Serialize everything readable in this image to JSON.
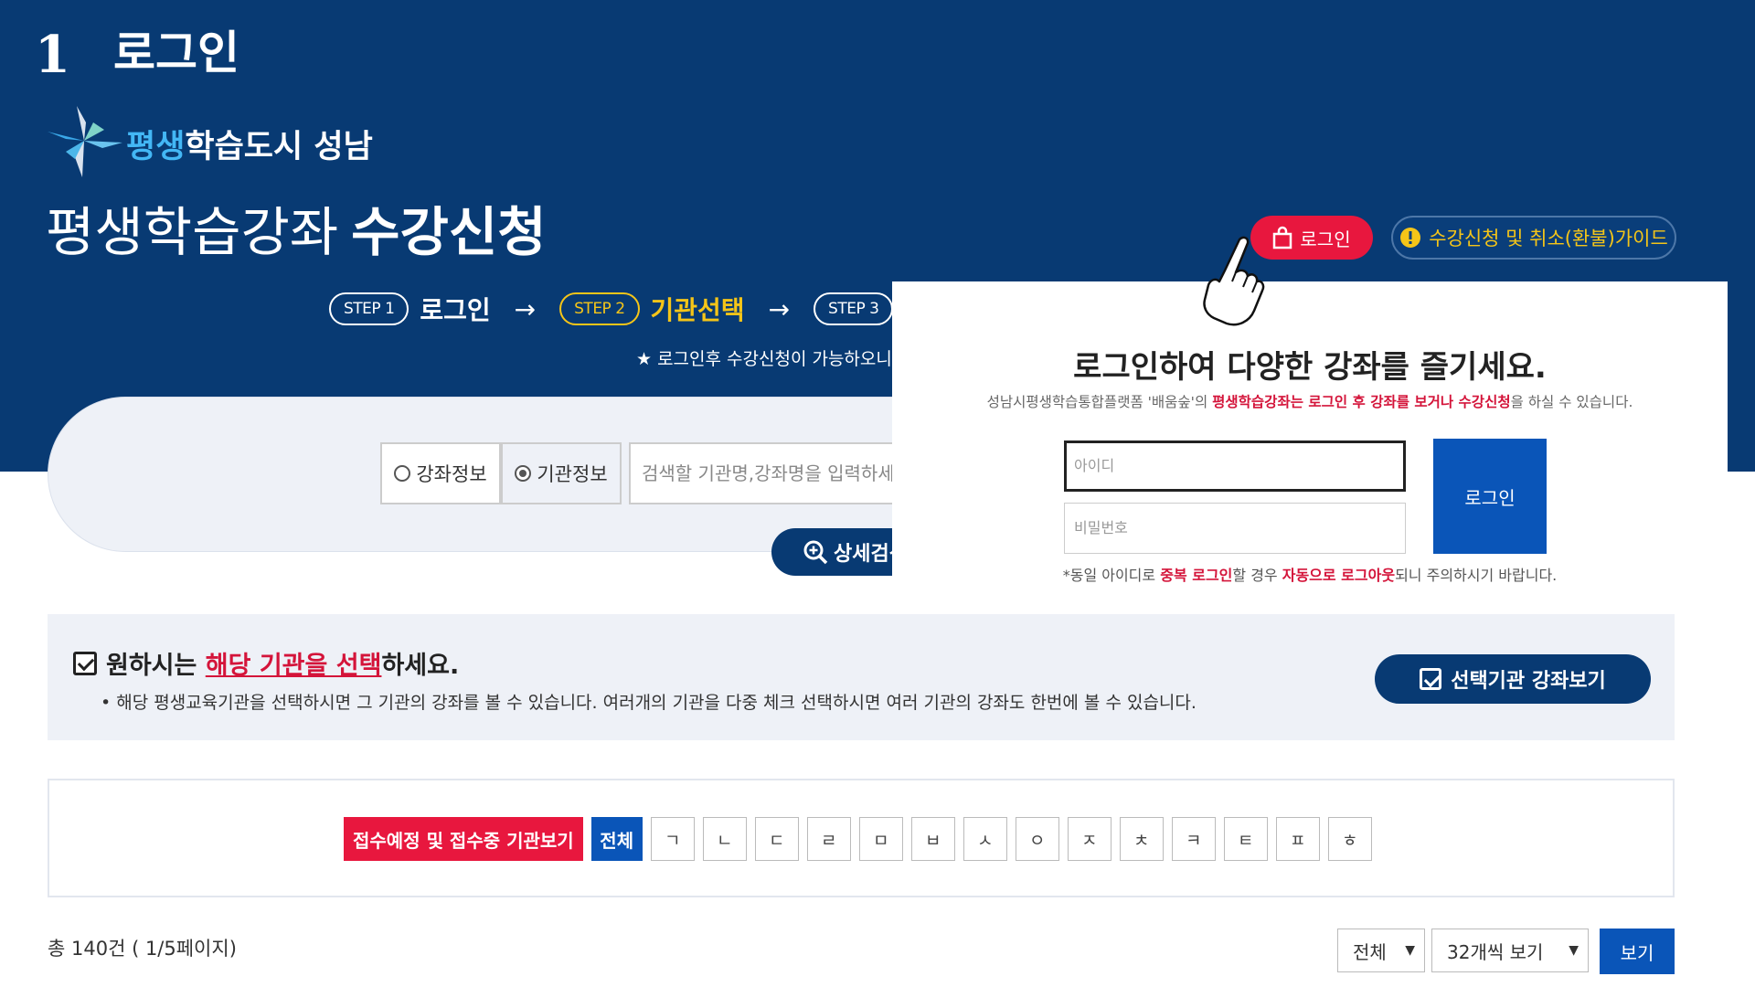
{
  "step_header": {
    "number": "1",
    "label": "로그인"
  },
  "logo": {
    "accent": "평생",
    "rest": "학습도시 성남"
  },
  "title": {
    "light": "평생학습강좌",
    "bold": "수강신청"
  },
  "steps": [
    {
      "pill": "STEP 1",
      "name": "로그인"
    },
    {
      "pill": "STEP 2",
      "name": "기관선택"
    },
    {
      "pill": "STEP 3"
    }
  ],
  "steps_arrow": "→",
  "notice": "★ 로그인후 수강신청이 가능하오니",
  "header_buttons": {
    "login": "로그인",
    "guide": "수강신청 및 취소(환불)가이드"
  },
  "search": {
    "radio_course": "강좌정보",
    "radio_institution": "기관정보",
    "placeholder": "검색할 기관명,강좌명을 입력하세요",
    "detail_button": "상세검색"
  },
  "modal": {
    "title": "로그인하여 다양한 강좌를 즐기세요.",
    "desc_prefix": "성남시평생학습통합플랫폼 '배움숲'의 ",
    "desc_red": "평생학습강좌는 로그인 후 강좌를 보거나 수강신청",
    "desc_suffix": "을 하실 수 있습니다.",
    "id_placeholder": "아이디",
    "pw_placeholder": "비밀번호",
    "login_button": "로그인",
    "note_1": "*동일 아이디로 ",
    "note_red_1": "중복 로그인",
    "note_2": "할 경우 ",
    "note_red_2": "자동으로 로그아웃",
    "note_3": "되니 주의하시기 바랍니다."
  },
  "select_section": {
    "heading_1": "원하시는 ",
    "heading_hl": "해당 기관을 선택",
    "heading_2": "하세요.",
    "desc": "• 해당 평생교육기관을 선택하시면 그 기관의 강좌를 볼 수 있습니다. 여러개의 기관을 다중 체크 선택하시면 여러 기관의 강좌도 한번에 볼 수 있습니다.",
    "view_button": "선택기관 강좌보기"
  },
  "filter": {
    "reception_button": "접수예정 및 접수중 기관보기",
    "all_button": "전체",
    "consonants": [
      "ㄱ",
      "ㄴ",
      "ㄷ",
      "ㄹ",
      "ㅁ",
      "ㅂ",
      "ㅅ",
      "ㅇ",
      "ㅈ",
      "ㅊ",
      "ㅋ",
      "ㅌ",
      "ㅍ",
      "ㅎ"
    ]
  },
  "list_footer": {
    "total": "총 140건 ( 1/5페이지)",
    "select_all": "전체",
    "select_count": "32개씩 보기",
    "view_button": "보기"
  },
  "colors": {
    "navy": "#083a73",
    "red": "#e8173e",
    "blue": "#0a55b8",
    "yellow": "#f5c518",
    "panel": "#eef1f7"
  }
}
